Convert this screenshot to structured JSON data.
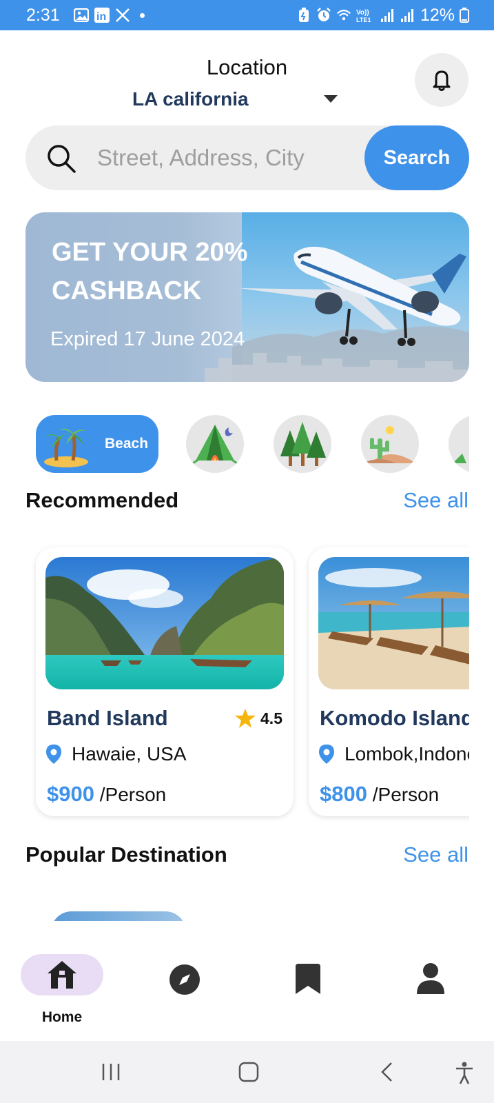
{
  "status_bar": {
    "time": "2:31",
    "battery": "12%",
    "icons": [
      "gallery-icon",
      "linkedin-icon",
      "x-icon",
      "dot-icon",
      "battery-saver-icon",
      "alarm-icon",
      "wifi-icon",
      "volte-icon",
      "signal-icon",
      "signal-icon",
      "battery-icon"
    ],
    "volte_text": "Vo)) LTE1",
    "linkedin_text": "in"
  },
  "header": {
    "location_label": "Location",
    "location_value": "LA california"
  },
  "search": {
    "placeholder": "Street, Address, City",
    "button_label": "Search"
  },
  "banner": {
    "title": "GET YOUR 20% CASHBACK",
    "subtitle": "Expired 17 June 2024"
  },
  "categories": [
    {
      "label": "Beach",
      "icon": "palm-island-icon",
      "active": true
    },
    {
      "label": "",
      "icon": "camping-tent-icon",
      "active": false
    },
    {
      "label": "",
      "icon": "forest-icon",
      "active": false
    },
    {
      "label": "",
      "icon": "desert-cactus-icon",
      "active": false
    }
  ],
  "recommended": {
    "title": "Recommended",
    "see_all": "See all",
    "items": [
      {
        "name": "Band Island",
        "rating": "4.5",
        "location": "Hawaie, USA",
        "price": "$900",
        "per": "/Person"
      },
      {
        "name": "Komodo Island",
        "location": "Lombok,Indonesia",
        "price": "$800",
        "per": "/Person"
      }
    ]
  },
  "popular": {
    "title": "Popular Destination",
    "see_all": "See all"
  },
  "bottom_nav": {
    "items": [
      {
        "label": "Home",
        "icon": "home-icon",
        "active": true
      },
      {
        "label": "",
        "icon": "compass-icon",
        "active": false
      },
      {
        "label": "",
        "icon": "bookmark-icon",
        "active": false
      },
      {
        "label": "",
        "icon": "profile-icon",
        "active": false
      }
    ]
  },
  "colors": {
    "accent": "#3f92ea",
    "title_navy": "#22395e",
    "nav_pill": "#e9dcf5"
  }
}
